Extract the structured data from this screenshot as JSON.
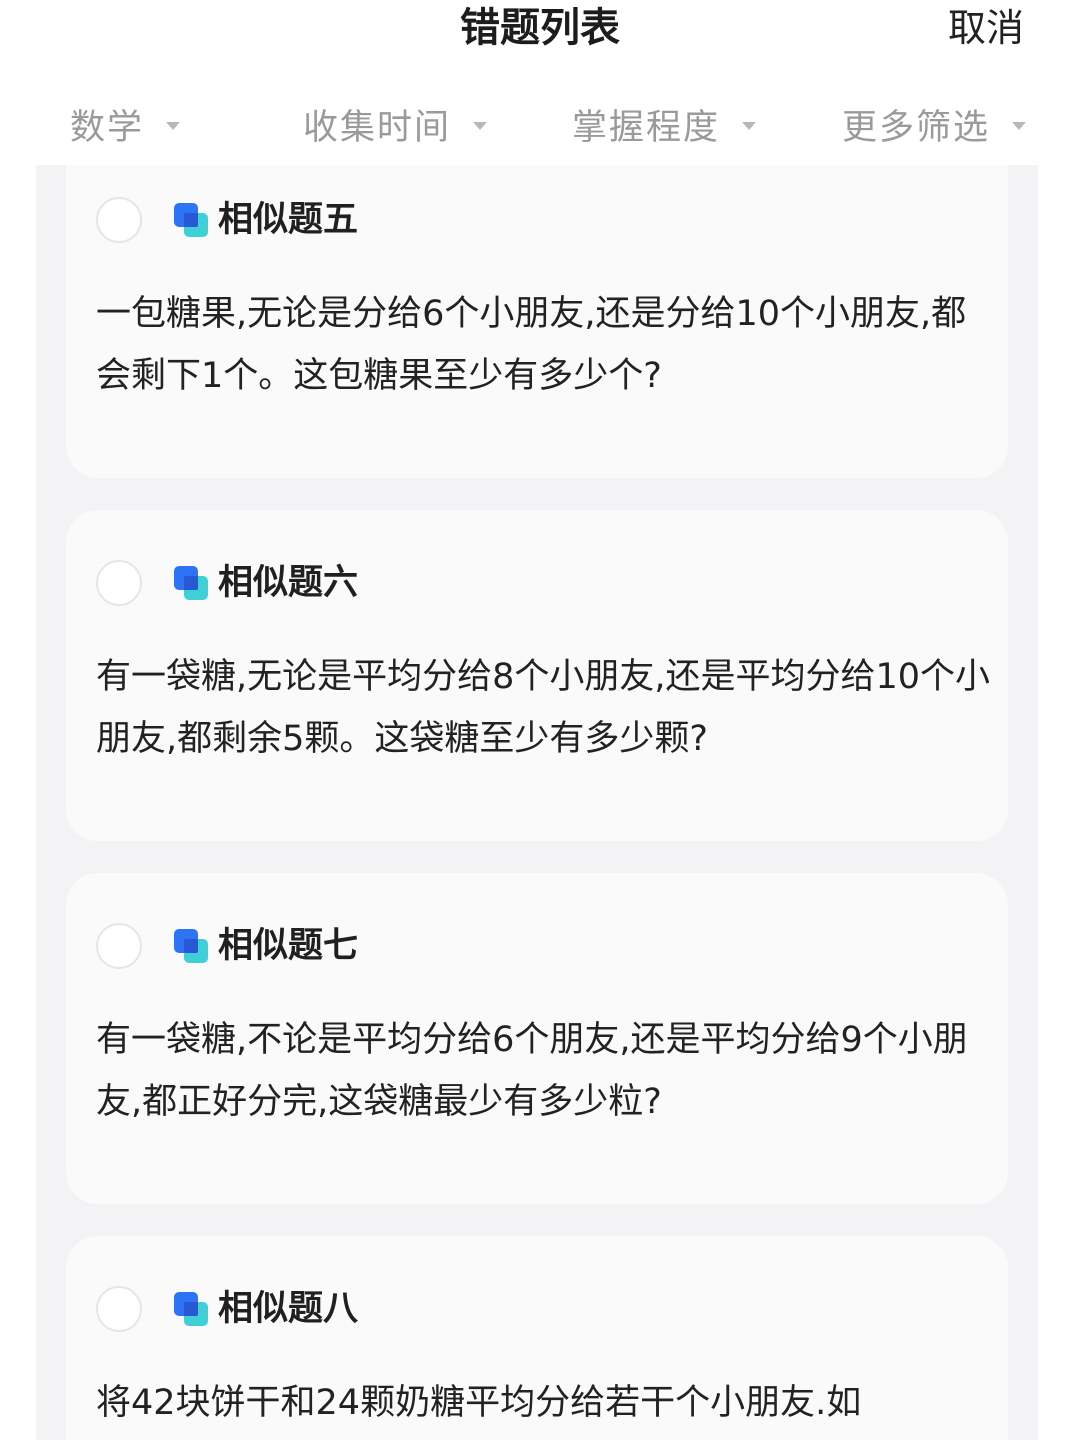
{
  "header": {
    "title": "错题列表",
    "cancel_label": "取消"
  },
  "filters": [
    {
      "label": "数学"
    },
    {
      "label": "收集时间"
    },
    {
      "label": "掌握程度"
    },
    {
      "label": "更多筛选"
    }
  ],
  "cards": [
    {
      "title": "相似题五",
      "body": "一包糖果,无论是分给6个小朋友,还是分给10个小朋友,都会剩下1个。这包糖果至少有多少个?"
    },
    {
      "title": "相似题六",
      "body": "有一袋糖,无论是平均分给8个小朋友,还是平均分给10个小朋友,都剩余5颗。这袋糖至少有多少颗?"
    },
    {
      "title": "相似题七",
      "body": "有一袋糖,不论是平均分给6个朋友,还是平均分给9个小朋友,都正好分完,这袋糖最少有多少粒?"
    },
    {
      "title": "相似题八",
      "body": "将42块饼干和24颗奶糖平均分给若干个小朋友.如"
    }
  ],
  "colors": {
    "accent_blue": "#2d74f5",
    "accent_cyan": "#3fcfd6",
    "filter_text": "#9a9a9a",
    "content_bg": "#f3f3f5",
    "card_bg": "#fafafa"
  },
  "icons": [
    "caret-down-icon",
    "question-tag-icon",
    "select-circle"
  ]
}
